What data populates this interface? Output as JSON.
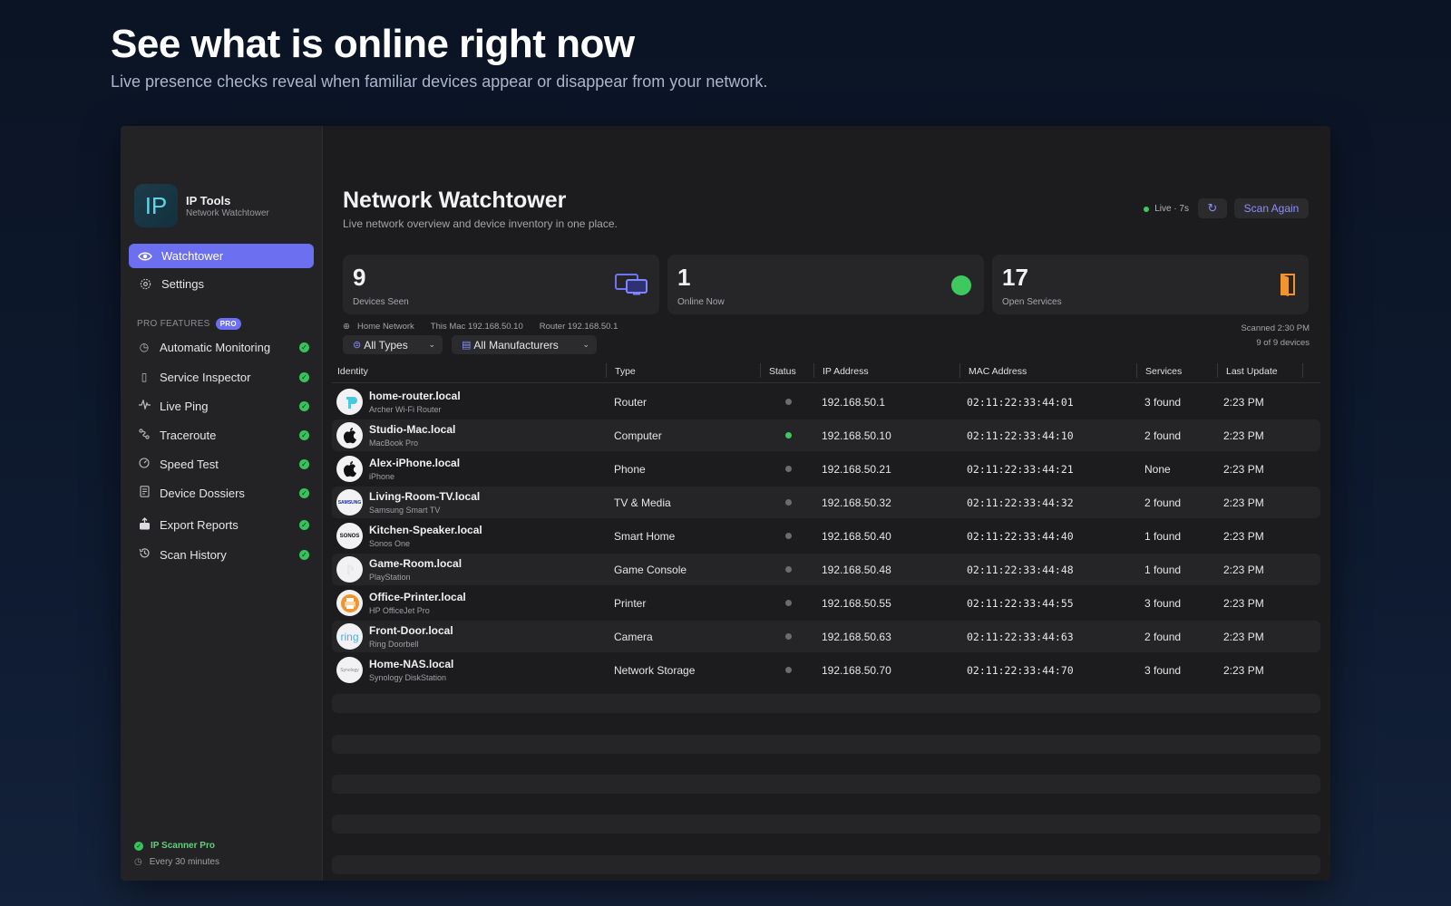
{
  "hero": {
    "title": "See what is online right now",
    "subtitle": "Live presence checks reveal when familiar devices appear or disappear from your network."
  },
  "app": {
    "logo_text": "IP",
    "name": "IP Tools",
    "tagline": "Network Watchtower"
  },
  "sidebar": {
    "nav": [
      {
        "label": "Watchtower",
        "icon": "eye-icon",
        "active": true
      },
      {
        "label": "Settings",
        "icon": "gear-icon",
        "active": false
      }
    ],
    "section_label": "PRO FEATURES",
    "pro_badge": "PRO",
    "pro_items": [
      {
        "label": "Automatic Monitoring",
        "icon": "clock-check-icon"
      },
      {
        "label": "Service Inspector",
        "icon": "door-icon"
      },
      {
        "label": "Live Ping",
        "icon": "pulse-icon"
      },
      {
        "label": "Traceroute",
        "icon": "route-icon"
      },
      {
        "label": "Speed Test",
        "icon": "gauge-icon"
      },
      {
        "label": "Device Dossiers",
        "icon": "document-icon"
      },
      {
        "label": "Export Reports",
        "icon": "export-icon"
      },
      {
        "label": "Scan History",
        "icon": "history-icon"
      }
    ],
    "footer": {
      "plan": "IP Scanner Pro",
      "interval": "Every 30 minutes"
    }
  },
  "main": {
    "title": "Network Watchtower",
    "subtitle": "Live network overview and device inventory in one place.",
    "live_text": "Live · 7s",
    "scan_label": "Scan Again",
    "stats": [
      {
        "value": "9",
        "label": "Devices Seen",
        "icon": "monitors-icon"
      },
      {
        "value": "1",
        "label": "Online Now",
        "icon": "online-dot-icon"
      },
      {
        "value": "17",
        "label": "Open Services",
        "icon": "door-icon"
      }
    ],
    "meta": {
      "network": "Home Network",
      "this_mac": "This Mac 192.168.50.10",
      "router": "Router 192.168.50.1",
      "scanned": "Scanned 2:30 PM",
      "count": "9 of 9 devices"
    },
    "filters": {
      "types": "All Types",
      "manufacturers": "All Manufacturers"
    },
    "table": {
      "columns": [
        "Identity",
        "Type",
        "Status",
        "IP Address",
        "MAC Address",
        "Services",
        "Last Update"
      ],
      "rows": [
        {
          "name": "home-router.local",
          "model": "Archer Wi-Fi Router",
          "type": "Router",
          "online": false,
          "ip": "192.168.50.1",
          "mac": "02:11:22:33:44:01",
          "services": "3 found",
          "updated": "2:23 PM",
          "brand": "tplink"
        },
        {
          "name": "Studio-Mac.local",
          "model": "MacBook Pro",
          "type": "Computer",
          "online": true,
          "ip": "192.168.50.10",
          "mac": "02:11:22:33:44:10",
          "services": "2 found",
          "updated": "2:23 PM",
          "brand": "apple"
        },
        {
          "name": "Alex-iPhone.local",
          "model": "iPhone",
          "type": "Phone",
          "online": false,
          "ip": "192.168.50.21",
          "mac": "02:11:22:33:44:21",
          "services": "None",
          "updated": "2:23 PM",
          "brand": "apple"
        },
        {
          "name": "Living-Room-TV.local",
          "model": "Samsung Smart TV",
          "type": "TV & Media",
          "online": false,
          "ip": "192.168.50.32",
          "mac": "02:11:22:33:44:32",
          "services": "2 found",
          "updated": "2:23 PM",
          "brand": "samsung"
        },
        {
          "name": "Kitchen-Speaker.local",
          "model": "Sonos One",
          "type": "Smart Home",
          "online": false,
          "ip": "192.168.50.40",
          "mac": "02:11:22:33:44:40",
          "services": "1 found",
          "updated": "2:23 PM",
          "brand": "sonos"
        },
        {
          "name": "Game-Room.local",
          "model": "PlayStation",
          "type": "Game Console",
          "online": false,
          "ip": "192.168.50.48",
          "mac": "02:11:22:33:44:48",
          "services": "1 found",
          "updated": "2:23 PM",
          "brand": "playstation"
        },
        {
          "name": "Office-Printer.local",
          "model": "HP OfficeJet Pro",
          "type": "Printer",
          "online": false,
          "ip": "192.168.50.55",
          "mac": "02:11:22:33:44:55",
          "services": "3 found",
          "updated": "2:23 PM",
          "brand": "printer"
        },
        {
          "name": "Front-Door.local",
          "model": "Ring Doorbell",
          "type": "Camera",
          "online": false,
          "ip": "192.168.50.63",
          "mac": "02:11:22:33:44:63",
          "services": "2 found",
          "updated": "2:23 PM",
          "brand": "ring"
        },
        {
          "name": "Home-NAS.local",
          "model": "Synology DiskStation",
          "type": "Network Storage",
          "online": false,
          "ip": "192.168.50.70",
          "mac": "02:11:22:33:44:70",
          "services": "3 found",
          "updated": "2:23 PM",
          "brand": "synology"
        }
      ]
    },
    "brand_text": {
      "samsung": "SAMSUNG",
      "sonos": "SONOS",
      "ring": "ring",
      "synology": "Synology"
    }
  }
}
